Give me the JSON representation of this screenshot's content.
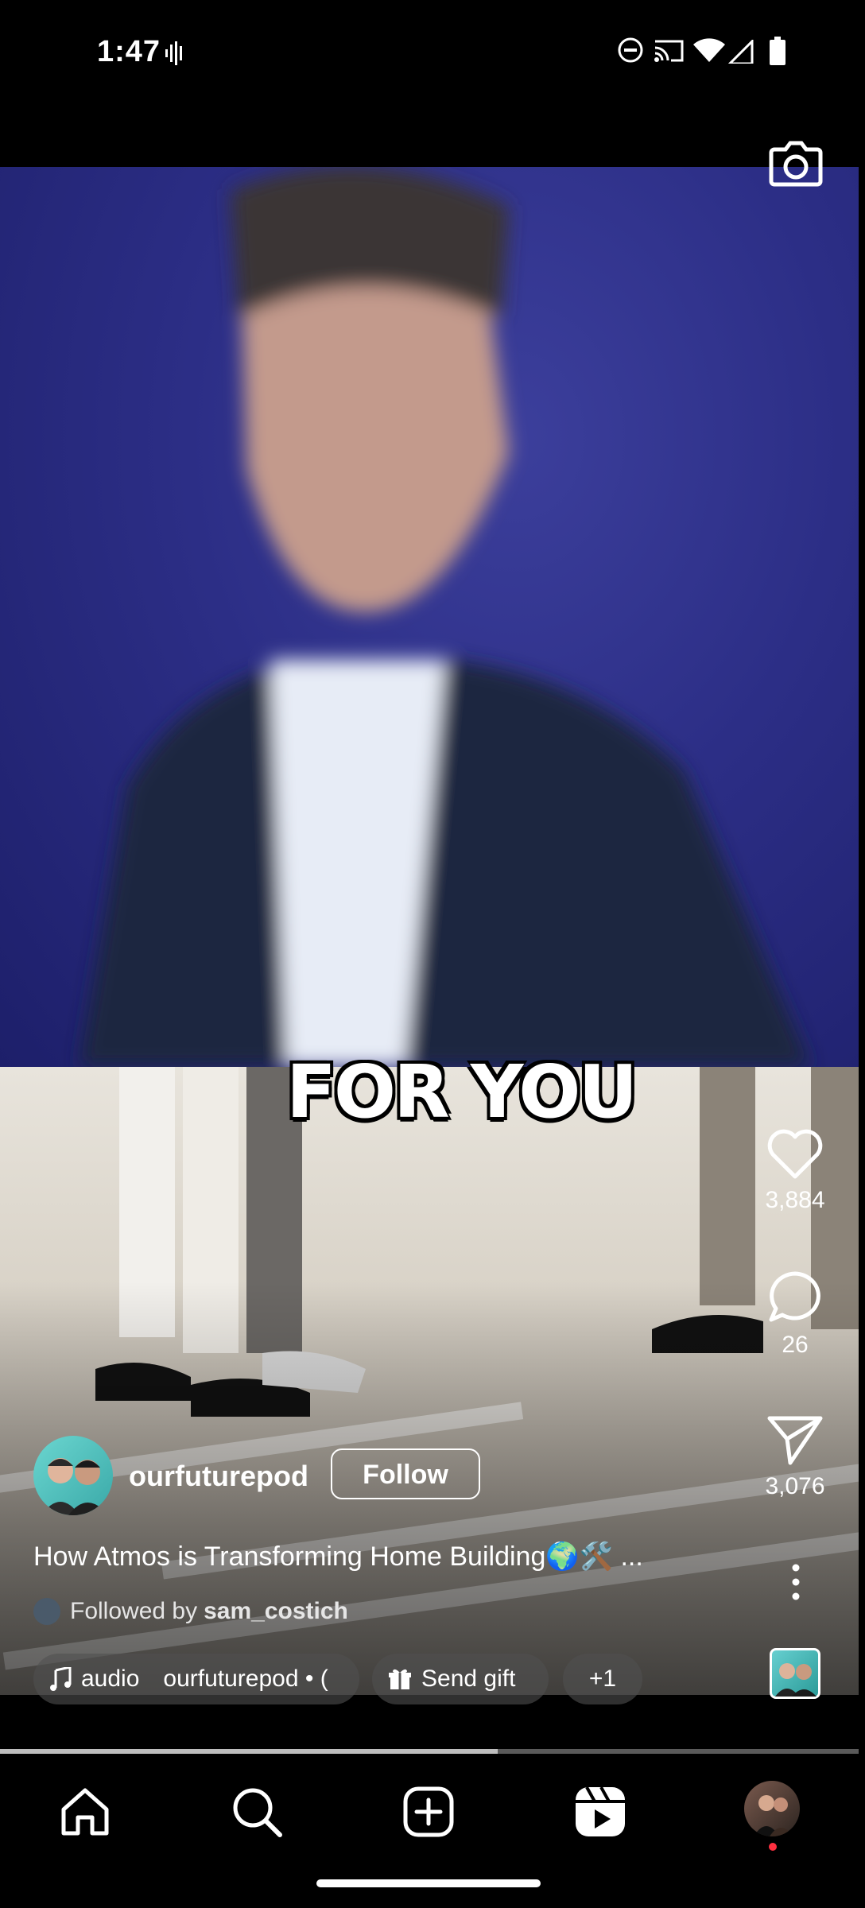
{
  "status_bar": {
    "time": "1:47",
    "icons": [
      "vibrate-icon",
      "dnd-icon",
      "cast-icon",
      "wifi-icon",
      "signal-icon",
      "battery-icon"
    ]
  },
  "video": {
    "overlay_text": "FOR YOU",
    "progress": 0.58
  },
  "actions": {
    "likes": "3,884",
    "comments": "26",
    "shares": "3,076"
  },
  "post": {
    "username": "ourfuturepod",
    "follow_label": "Follow",
    "caption": "How Atmos is Transforming Home Building🌍🛠️ ...",
    "followed_by_prefix": "Followed by",
    "followed_by_user": "sam_costich"
  },
  "pills": {
    "audio_label": "audio",
    "audio_source": "ourfuturepod • (",
    "gift_label": "Send gift",
    "more_label": "+1"
  },
  "nav": {
    "items": [
      "home-icon",
      "search-icon",
      "create-icon",
      "reels-icon",
      "profile-avatar"
    ]
  },
  "colors": {
    "background": "#000000",
    "backdrop_blue": "#2c2e86",
    "notification_dot": "#ff3040"
  }
}
